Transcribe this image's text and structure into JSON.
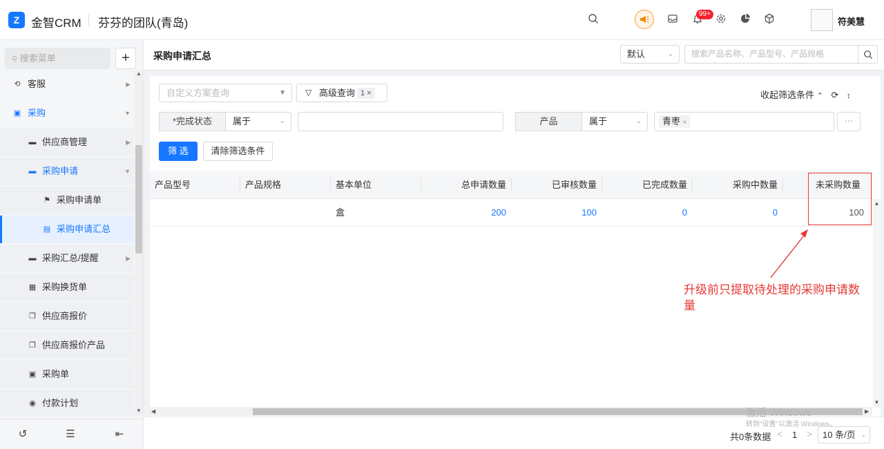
{
  "header": {
    "logo_glyph": "Z",
    "brand": "金智CRM",
    "team": "芬芬的团队(青岛)",
    "notification_badge": "99+",
    "user_name": "符美慧",
    "accent_color": "#1677ff"
  },
  "sidebar": {
    "search_placeholder": "搜索菜单",
    "add_label": "+",
    "items": [
      {
        "label": "客服",
        "icon": "headset-icon"
      },
      {
        "label": "采购",
        "icon": "bag-icon"
      },
      {
        "label": "供应商管理",
        "icon": "folder-icon"
      },
      {
        "label": "采购申请",
        "icon": "folder-icon"
      },
      {
        "label": "采购申请单",
        "icon": "flag-icon"
      },
      {
        "label": "采购申请汇总",
        "icon": "document-icon"
      },
      {
        "label": "采购汇总/提醒",
        "icon": "folder-icon"
      },
      {
        "label": "采购换货单",
        "icon": "box-icon"
      },
      {
        "label": "供应商报价",
        "icon": "copy-icon"
      },
      {
        "label": "供应商报价产品",
        "icon": "copy-icon"
      },
      {
        "label": "采购单",
        "icon": "bag-icon"
      },
      {
        "label": "付款计划",
        "icon": "circle-icon"
      }
    ]
  },
  "page": {
    "title": "采购申请汇总",
    "view_select": "默认",
    "search_placeholder": "搜索产品名称、产品型号、产品规格"
  },
  "filters": {
    "scheme_placeholder": "自定义方案查询",
    "advanced_label": "高级查询",
    "advanced_count": "1",
    "advanced_close": "×",
    "collapse_label": "收起筛选条件",
    "field1_label": "*完成状态",
    "field1_op": "属于",
    "field2_label": "产品",
    "field2_op": "属于",
    "field2_tag": "青枣",
    "field2_tag_close": "×",
    "more": "···",
    "filter_button": "筛 选",
    "clear_button": "清除筛选条件"
  },
  "table": {
    "columns": [
      "产品型号",
      "产品规格",
      "基本单位",
      "总申请数量",
      "已审核数量",
      "已完成数量",
      "采购中数量",
      "未采购数量"
    ],
    "rows": [
      {
        "model": "",
        "spec": "",
        "unit": "盒",
        "total": "200",
        "approved": "100",
        "completed": "0",
        "purchasing": "0",
        "unpurchased": "100"
      }
    ]
  },
  "annotation": {
    "text": "升级前只提取待处理的采购申请数量",
    "color": "#e53935"
  },
  "watermark": {
    "line1": "激活 Windows",
    "line2": "转到\"设置\"以激活 Windows。"
  },
  "pagination": {
    "total": "共0条数据",
    "prev": "<",
    "page": "1",
    "next": ">",
    "page_size": "10 条/页"
  }
}
